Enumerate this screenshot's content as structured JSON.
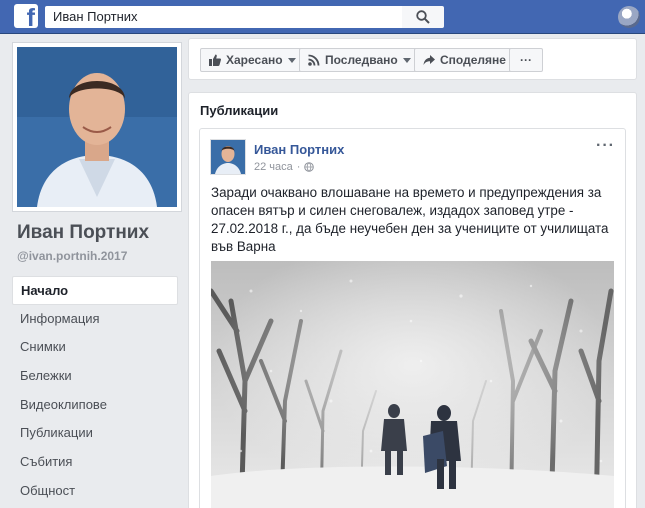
{
  "topbar": {
    "logo_letter": "f",
    "search_value": "Иван Портних"
  },
  "profile": {
    "name": "Иван Портних",
    "handle": "@ivan.portnih.2017"
  },
  "nav": {
    "items": [
      "Начало",
      "Информация",
      "Снимки",
      "Бележки",
      "Видеоклипове",
      "Публикации",
      "Събития",
      "Общност"
    ]
  },
  "actions": {
    "like": "Харесано",
    "follow": "Последвано",
    "share": "Споделяне",
    "more": "···"
  },
  "posts_section": {
    "title": "Публикации",
    "post": {
      "author": "Иван Портних",
      "time": "22 часа",
      "menu": "···",
      "text": "Заради очаквано влошаване на времето и предупреждения за опасен вятър и силен снеговалеж, издадох заповед утре - 27.02.2018 г., да бъде неучебен ден за учениците от училищата във Варна"
    }
  },
  "colors": {
    "brand": "#4267b2",
    "link": "#365899",
    "background": "#e9ebee"
  }
}
